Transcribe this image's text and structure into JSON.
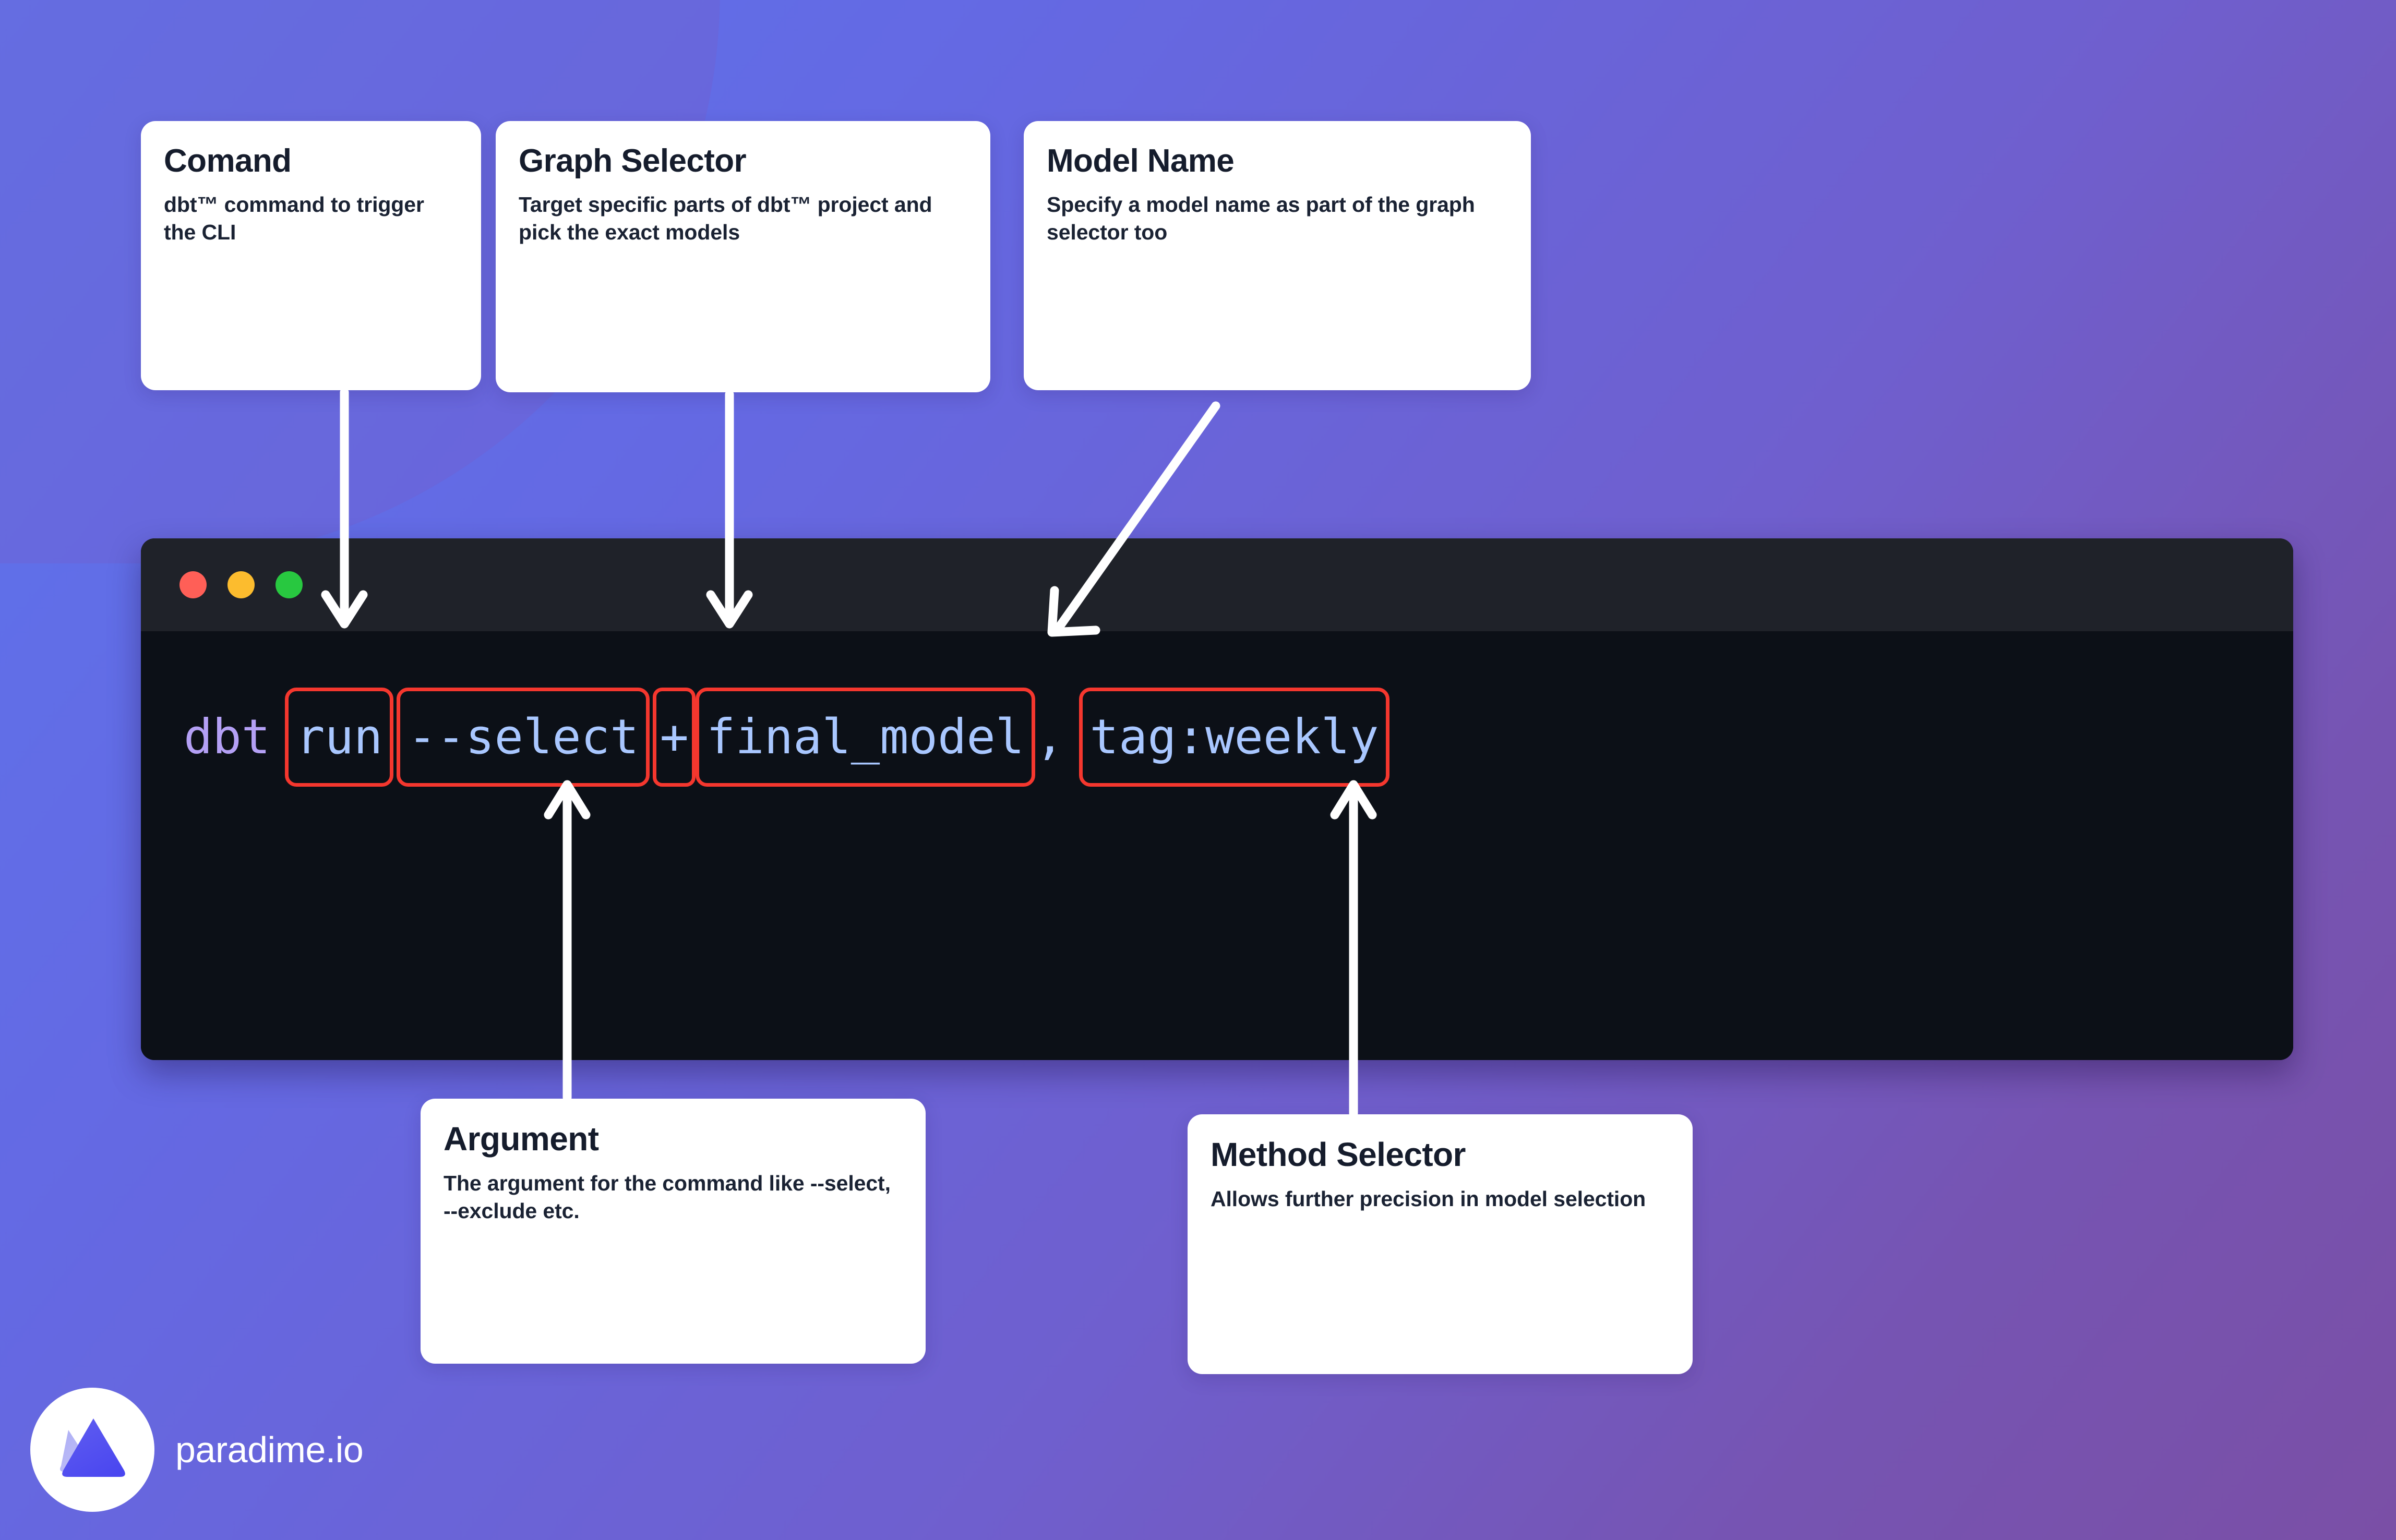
{
  "background": {
    "gradient_start": "#5D74EC",
    "gradient_end": "#7A4FA6"
  },
  "cards": {
    "command": {
      "title": "Comand",
      "body": "dbt™ command to trigger the CLI"
    },
    "graph_selector": {
      "title": "Graph Selector",
      "body": "Target specific parts of dbt™ project and pick the exact models"
    },
    "model_name": {
      "title": "Model Name",
      "body": "Specify a model name as part of the graph selector too"
    },
    "argument": {
      "title": "Argument",
      "body": "The argument for the command like --select, --exclude etc."
    },
    "method_selector": {
      "title": "Method Selector",
      "body": "Allows further precision in model selection"
    }
  },
  "terminal": {
    "window_controls": [
      {
        "name": "close",
        "color": "#FF5F57"
      },
      {
        "name": "minimize",
        "color": "#FCBC2E"
      },
      {
        "name": "zoom",
        "color": "#28C840"
      }
    ],
    "title_bar_color": "#1F2229",
    "body_color": "#0C1017",
    "highlight_color": "#F5372E",
    "command": {
      "full_text": "dbt run --select +final_model, tag:weekly",
      "tokens": [
        {
          "text": "dbt",
          "color": "#B4A0F5",
          "highlighted": false
        },
        {
          "text": "run",
          "color": "#A9C7FF",
          "highlighted": true
        },
        {
          "text": "--select",
          "color": "#A9C7FF",
          "highlighted": true
        },
        {
          "text": "+",
          "color": "#A9C7FF",
          "highlighted": true
        },
        {
          "text": "final_model",
          "color": "#A9C7FF",
          "highlighted": true
        },
        {
          "text": ",",
          "color": "#A9C7FF",
          "highlighted": false
        },
        {
          "text": "tag:weekly",
          "color": "#A9C7FF",
          "highlighted": true
        }
      ]
    }
  },
  "footer": {
    "brand": "paradime.io"
  }
}
